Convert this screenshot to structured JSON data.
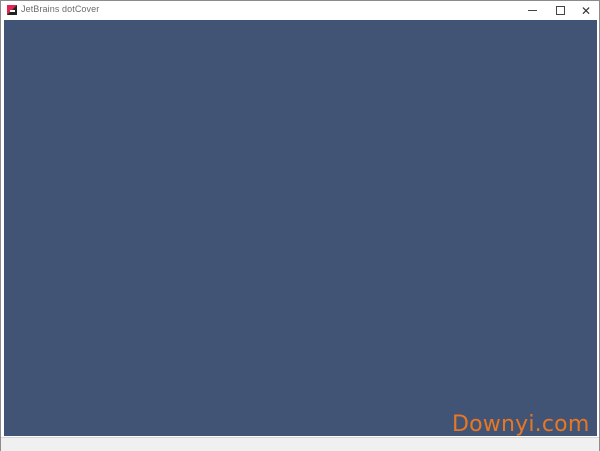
{
  "window": {
    "title": "JetBrains dotCover",
    "icon": "jetbrains-dotcover-icon"
  },
  "controls": {
    "minimize": "minimize-icon",
    "maximize": "maximize-icon",
    "close": "close-icon",
    "close_glyph": "✕"
  },
  "colors": {
    "client_background": "#415475",
    "watermark": "#e87722"
  },
  "watermark": {
    "text": "Downyi.com"
  }
}
